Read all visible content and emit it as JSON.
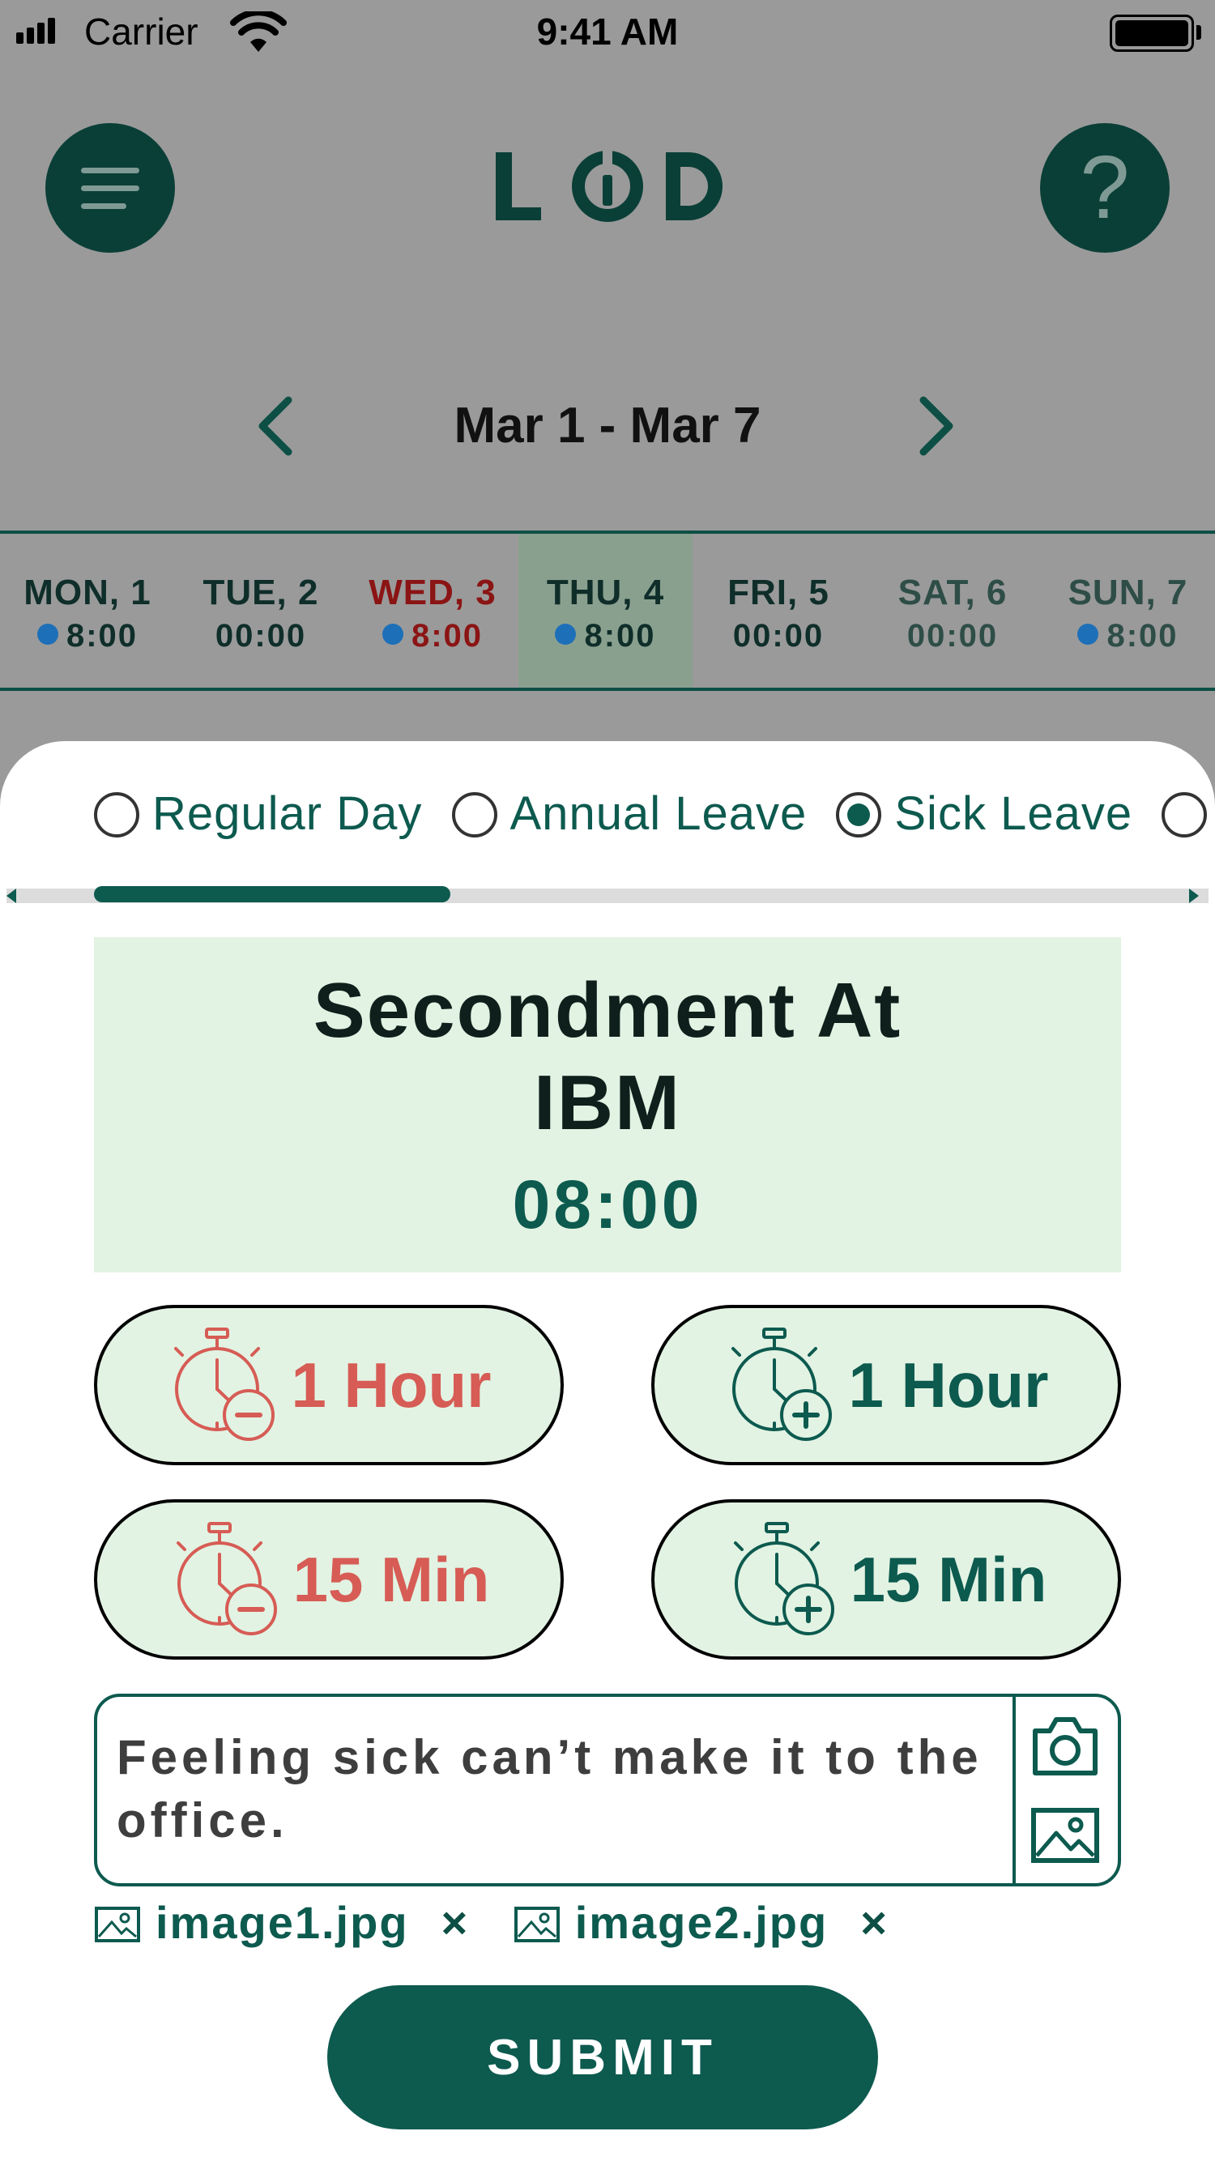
{
  "status_bar": {
    "carrier": "Carrier",
    "time": "9:41 AM"
  },
  "header": {
    "logo_text": "LOD",
    "help_label": "?"
  },
  "week": {
    "range": "Mar 1 - Mar 7"
  },
  "days": [
    {
      "name": "MON, 1",
      "hours": "8:00",
      "dot": true,
      "color": "#0f2e2a"
    },
    {
      "name": "TUE, 2",
      "hours": "00:00",
      "dot": false,
      "color": "#0f2e2a"
    },
    {
      "name": "WED, 3",
      "hours": "8:00",
      "dot": true,
      "color": "#8b1414"
    },
    {
      "name": "THU, 4",
      "hours": "8:00",
      "dot": true,
      "color": "#0f2e2a",
      "selected": true
    },
    {
      "name": "FRI, 5",
      "hours": "00:00",
      "dot": false,
      "color": "#0f2e2a"
    },
    {
      "name": "SAT, 6",
      "hours": "00:00",
      "dot": false,
      "color": "#2e4d47"
    },
    {
      "name": "SUN, 7",
      "hours": "8:00",
      "dot": true,
      "color": "#2e4d47"
    }
  ],
  "day_types": [
    {
      "label": "Regular Day",
      "selected": false
    },
    {
      "label": "Annual Leave",
      "selected": false
    },
    {
      "label": "Sick Leave",
      "selected": true
    }
  ],
  "project": {
    "line1": "Secondment At",
    "line2": "IBM",
    "hours": "08:00"
  },
  "adjust": {
    "minus_hour": "1 Hour",
    "plus_hour": "1 Hour",
    "minus_min": "15 Min",
    "plus_min": "15 Min"
  },
  "note": {
    "text": "Feeling sick can’t make it to the office."
  },
  "attachments": [
    "image1.jpg",
    "image2.jpg"
  ],
  "submit_label": "SUBMIT",
  "colors": {
    "brand": "#0d5a4f",
    "minus": "#d65c55",
    "card": "#e2f3e3",
    "weekend_dot": "#1d6fb8"
  }
}
